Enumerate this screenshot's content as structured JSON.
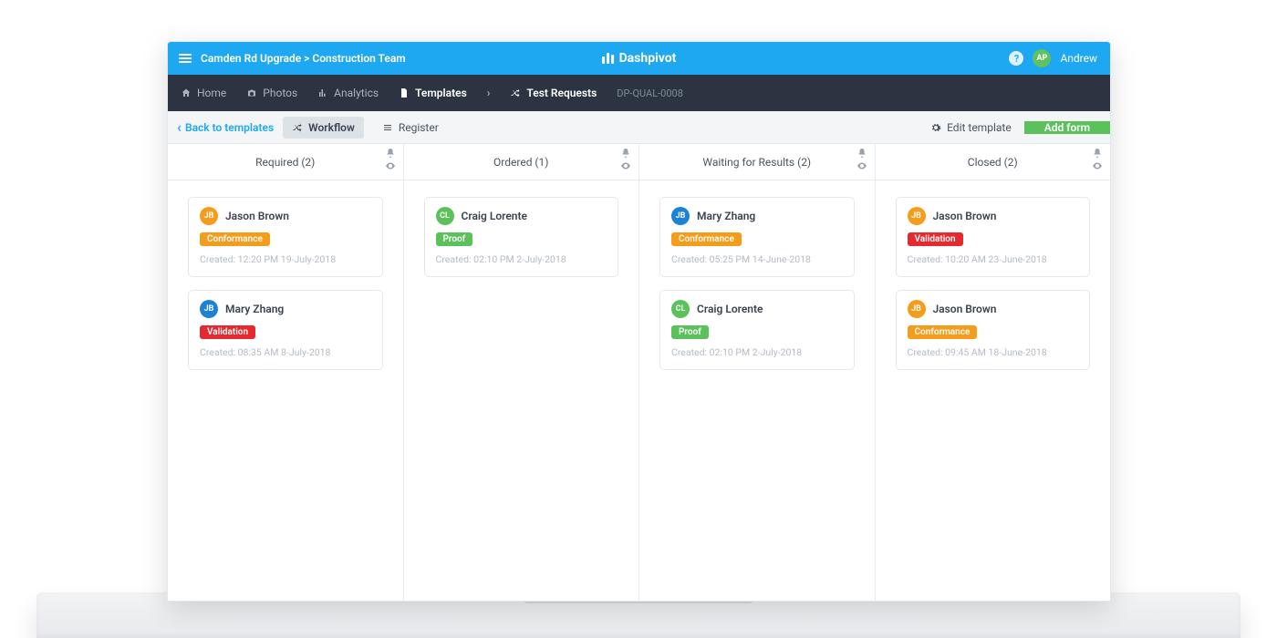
{
  "brand": {
    "name": "Dashpivot"
  },
  "topbar": {
    "breadcrumb": "Camden Rd Upgrade > Construction Team",
    "help_label": "?",
    "user_initials": "AP",
    "user_name": "Andrew"
  },
  "nav": {
    "home": "Home",
    "photos": "Photos",
    "analytics": "Analytics",
    "templates": "Templates",
    "test_requests": "Test Requests",
    "doc_code": "DP-QUAL-0008"
  },
  "toolbar": {
    "back_label": "Back to templates",
    "workflow_label": "Workflow",
    "register_label": "Register",
    "edit_template_label": "Edit template",
    "add_form_label": "Add form"
  },
  "tags": {
    "conformance": {
      "label": "Conformance",
      "color": "#f59c1a"
    },
    "validation": {
      "label": "Validation",
      "color": "#e6292f"
    },
    "proof": {
      "label": "Proof",
      "color": "#5bc15b"
    }
  },
  "avatars": {
    "orange": "#f59c1a",
    "blue": "#1c82d6",
    "green": "#5bc15b"
  },
  "columns": [
    {
      "title": "Required (2)",
      "cards": [
        {
          "initials": "JB",
          "avatar": "orange",
          "name": "Jason Brown",
          "tag": "conformance",
          "created": "Created: 12:20 PM 19-July-2018"
        },
        {
          "initials": "JB",
          "avatar": "blue",
          "name": "Mary Zhang",
          "tag": "validation",
          "created": "Created: 08:35 AM 8-July-2018"
        }
      ]
    },
    {
      "title": "Ordered (1)",
      "cards": [
        {
          "initials": "CL",
          "avatar": "green",
          "name": "Craig Lorente",
          "tag": "proof",
          "created": "Created: 02:10 PM 2-July-2018"
        }
      ]
    },
    {
      "title": "Waiting for Results (2)",
      "cards": [
        {
          "initials": "JB",
          "avatar": "blue",
          "name": "Mary Zhang",
          "tag": "conformance",
          "created": "Created: 05:25 PM 14-June-2018"
        },
        {
          "initials": "CL",
          "avatar": "green",
          "name": "Craig Lorente",
          "tag": "proof",
          "created": "Created: 02:10 PM 2-July-2018"
        }
      ]
    },
    {
      "title": "Closed (2)",
      "cards": [
        {
          "initials": "JB",
          "avatar": "orange",
          "name": "Jason Brown",
          "tag": "validation",
          "created": "Created: 10:20 AM 23-June-2018"
        },
        {
          "initials": "JB",
          "avatar": "orange",
          "name": "Jason Brown",
          "tag": "conformance",
          "created": "Created: 09:45 AM 18-June-2018"
        }
      ]
    }
  ]
}
